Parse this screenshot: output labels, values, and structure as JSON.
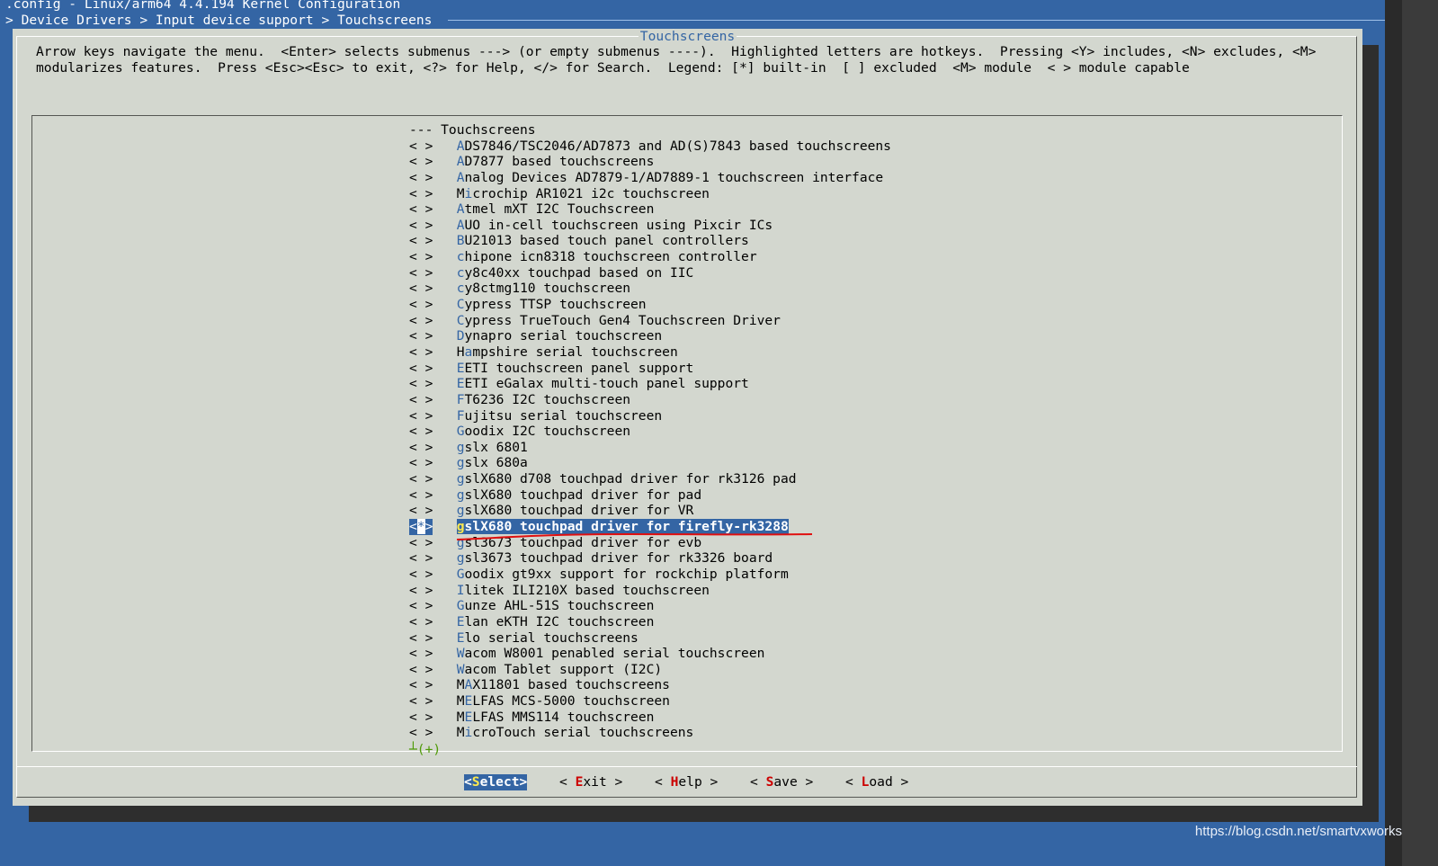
{
  "window": {
    "title": ".config - Linux/arm64 4.4.194 Kernel Configuration",
    "breadcrumb": "> Device Drivers > Input device support > Touchscreens"
  },
  "dialog": {
    "title": "Touchscreens",
    "help_line1": "Arrow keys navigate the menu.  <Enter> selects submenus ---> (or empty submenus ----).  Highlighted letters are hotkeys.  Pressing <Y> includes, <N> excludes, <M>",
    "help_line2": "modularizes features.  Press <Esc><Esc> to exit, <?> for Help, </> for Search.  Legend: [*] built-in  [ ] excluded  <M> module  < > module capable"
  },
  "menu": {
    "header": "--- Touchscreens",
    "more_indicator": "(+)",
    "items": [
      {
        "bracket": "< >",
        "hk": "A",
        "rest": "DS7846/TSC2046/AD7873 and AD(S)7843 based touchscreens"
      },
      {
        "bracket": "< >",
        "hk": "A",
        "rest": "D7877 based touchscreens"
      },
      {
        "bracket": "< >",
        "hk": "A",
        "rest": "nalog Devices AD7879-1/AD7889-1 touchscreen interface"
      },
      {
        "bracket": "< >",
        "pre": "M",
        "hk": "i",
        "rest": "crochip AR1021 i2c touchscreen"
      },
      {
        "bracket": "< >",
        "hk": "A",
        "rest": "tmel mXT I2C Touchscreen"
      },
      {
        "bracket": "< >",
        "hk": "A",
        "rest": "UO in-cell touchscreen using Pixcir ICs"
      },
      {
        "bracket": "< >",
        "hk": "B",
        "rest": "U21013 based touch panel controllers"
      },
      {
        "bracket": "< >",
        "hk": "c",
        "rest": "hipone icn8318 touchscreen controller"
      },
      {
        "bracket": "< >",
        "hk": "c",
        "rest": "y8c40xx touchpad based on IIC"
      },
      {
        "bracket": "< >",
        "hk": "c",
        "rest": "y8ctmg110 touchscreen"
      },
      {
        "bracket": "< >",
        "hk": "C",
        "rest": "ypress TTSP touchscreen"
      },
      {
        "bracket": "< >",
        "hk": "C",
        "rest": "ypress TrueTouch Gen4 Touchscreen Driver"
      },
      {
        "bracket": "< >",
        "hk": "D",
        "rest": "ynapro serial touchscreen"
      },
      {
        "bracket": "< >",
        "pre": "H",
        "hk": "a",
        "rest": "mpshire serial touchscreen"
      },
      {
        "bracket": "< >",
        "hk": "E",
        "rest": "ETI touchscreen panel support"
      },
      {
        "bracket": "< >",
        "hk": "E",
        "rest": "ETI eGalax multi-touch panel support"
      },
      {
        "bracket": "< >",
        "hk": "F",
        "rest": "T6236 I2C touchscreen"
      },
      {
        "bracket": "< >",
        "hk": "F",
        "rest": "ujitsu serial touchscreen"
      },
      {
        "bracket": "< >",
        "hk": "G",
        "rest": "oodix I2C touchscreen"
      },
      {
        "bracket": "< >",
        "hk": "g",
        "rest": "slx 6801"
      },
      {
        "bracket": "< >",
        "hk": "g",
        "rest": "slx 680a"
      },
      {
        "bracket": "< >",
        "hk": "g",
        "rest": "slX680 d708 touchpad driver for rk3126 pad"
      },
      {
        "bracket": "< >",
        "hk": "g",
        "rest": "slX680 touchpad driver for pad"
      },
      {
        "bracket": "< >",
        "hk": "g",
        "rest": "slX680 touchpad driver for VR"
      },
      {
        "bracket": "<*>",
        "hk": "g",
        "rest": "slX680 touchpad driver for firefly-rk3288",
        "selected": true
      },
      {
        "bracket": "< >",
        "hk": "g",
        "rest": "sl3673 touchpad driver for evb"
      },
      {
        "bracket": "< >",
        "hk": "g",
        "rest": "sl3673 touchpad driver for rk3326 board"
      },
      {
        "bracket": "< >",
        "hk": "G",
        "rest": "oodix gt9xx support for rockchip platform"
      },
      {
        "bracket": "< >",
        "hk": "I",
        "rest": "litek ILI210X based touchscreen"
      },
      {
        "bracket": "< >",
        "hk": "G",
        "rest": "unze AHL-51S touchscreen"
      },
      {
        "bracket": "< >",
        "hk": "E",
        "rest": "lan eKTH I2C touchscreen"
      },
      {
        "bracket": "< >",
        "hk": "E",
        "rest": "lo serial touchscreens"
      },
      {
        "bracket": "< >",
        "hk": "W",
        "rest": "acom W8001 penabled serial touchscreen"
      },
      {
        "bracket": "< >",
        "hk": "W",
        "rest": "acom Tablet support (I2C)"
      },
      {
        "bracket": "< >",
        "pre": "M",
        "hk": "A",
        "rest": "X11801 based touchscreens"
      },
      {
        "bracket": "< >",
        "pre": "M",
        "hk": "E",
        "rest": "LFAS MCS-5000 touchscreen"
      },
      {
        "bracket": "< >",
        "pre": "M",
        "hk": "E",
        "rest": "LFAS MMS114 touchscreen"
      },
      {
        "bracket": "< >",
        "pre": "M",
        "hk": "i",
        "rest": "croTouch serial touchscreens"
      }
    ]
  },
  "buttons": [
    {
      "pre": "<",
      "hk": "S",
      "rest": "elect>",
      "active": true
    },
    {
      "pre": "< ",
      "hk": "E",
      "rest": "xit >"
    },
    {
      "pre": "< ",
      "hk": "H",
      "rest": "elp >"
    },
    {
      "pre": "< ",
      "hk": "S",
      "rest": "ave >"
    },
    {
      "pre": "< ",
      "hk": "L",
      "rest": "oad >"
    }
  ],
  "watermark": "https://blog.csdn.net/smartvxworks",
  "colors": {
    "background": "#3465a4",
    "dialog": "#d3d7cf",
    "hotkey": "#3465a4",
    "selection": "#3465a4",
    "button_hotkey": "#cc0000",
    "annotation": "#e01010"
  }
}
